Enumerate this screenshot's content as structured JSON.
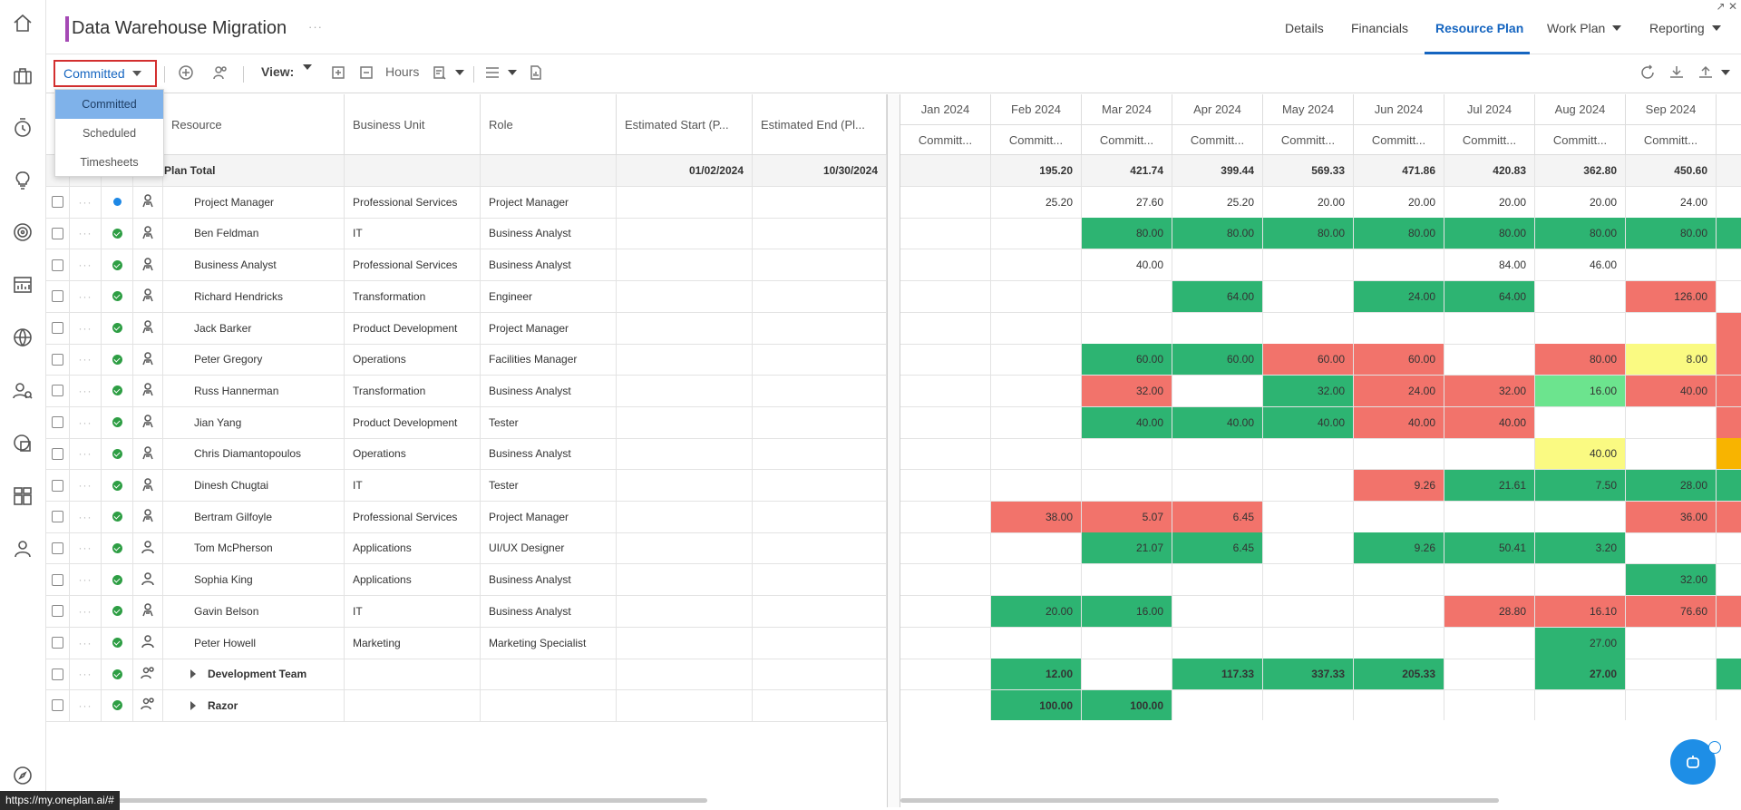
{
  "header": {
    "title": "Data Warehouse Migration",
    "title_more": "···",
    "tabs": [
      "Details",
      "Financials",
      "Resource Plan",
      "Work Plan",
      "Reporting"
    ],
    "active_tab": "Resource Plan"
  },
  "toolbar": {
    "mode_label": "Committed",
    "view_label": "View:",
    "units_label": "Hours"
  },
  "dropdown": {
    "options": [
      "Committed",
      "Scheduled",
      "Timesheets"
    ],
    "selected": "Committed"
  },
  "grid": {
    "headers": {
      "resource": "Resource",
      "business_unit": "Business Unit",
      "role": "Role",
      "est_start": "Estimated Start (P...",
      "est_end": "Estimated End (Pl..."
    },
    "months": [
      "Jan 2024",
      "Feb 2024",
      "Mar 2024",
      "Apr 2024",
      "May 2024",
      "Jun 2024",
      "Jul 2024",
      "Aug 2024",
      "Sep 2024"
    ],
    "month_sub": "Committ...",
    "month_sub_partial": "Co",
    "plan_total": {
      "label": "Plan Total",
      "start": "01/02/2024",
      "end": "10/30/2024",
      "values": [
        "",
        "195.20",
        "421.74",
        "399.44",
        "569.33",
        "471.86",
        "420.83",
        "362.80",
        "450.60"
      ]
    },
    "rows": [
      {
        "name": "Project Manager",
        "bu": "Professional Services",
        "role": "Project Manager",
        "status": "blue",
        "icon": "resource-generic",
        "values": [
          "",
          "25.20",
          "27.60",
          "25.20",
          "20.00",
          "20.00",
          "20.00",
          "20.00",
          "24.00"
        ],
        "colors": [
          "",
          "",
          "",
          "",
          "",
          "",
          "",
          "",
          "",
          ""
        ]
      },
      {
        "name": "Ben Feldman",
        "bu": "IT",
        "role": "Business Analyst",
        "status": "green",
        "icon": "resource-generic",
        "values": [
          "",
          "",
          "80.00",
          "80.00",
          "80.00",
          "80.00",
          "80.00",
          "80.00",
          "80.00"
        ],
        "colors": [
          "",
          "",
          "g",
          "g",
          "g",
          "g",
          "g",
          "g",
          "g",
          "g"
        ]
      },
      {
        "name": "Business Analyst",
        "bu": "Professional Services",
        "role": "Business Analyst",
        "status": "green",
        "icon": "resource-generic",
        "values": [
          "",
          "",
          "40.00",
          "",
          "",
          "",
          "84.00",
          "46.00",
          ""
        ],
        "colors": [
          "",
          "",
          "",
          "",
          "",
          "",
          "",
          "",
          "",
          ""
        ]
      },
      {
        "name": "Richard Hendricks",
        "bu": "Transformation",
        "role": "Engineer",
        "status": "green",
        "icon": "resource-generic",
        "values": [
          "",
          "",
          "",
          "64.00",
          "",
          "24.00",
          "64.00",
          "",
          "126.00"
        ],
        "colors": [
          "",
          "",
          "",
          "g",
          "",
          "g",
          "g",
          "",
          "r",
          ""
        ]
      },
      {
        "name": "Jack Barker",
        "bu": "Product Development",
        "role": "Project Manager",
        "status": "green",
        "icon": "resource-generic",
        "values": [
          "",
          "",
          "",
          "",
          "",
          "",
          "",
          "",
          ""
        ],
        "colors": [
          "",
          "",
          "",
          "",
          "",
          "",
          "",
          "",
          "",
          "r"
        ]
      },
      {
        "name": "Peter Gregory",
        "bu": "Operations",
        "role": "Facilities Manager",
        "status": "green",
        "icon": "resource-generic",
        "values": [
          "",
          "",
          "60.00",
          "60.00",
          "60.00",
          "60.00",
          "",
          "80.00",
          "8.00"
        ],
        "colors": [
          "",
          "",
          "g",
          "g",
          "r",
          "r",
          "",
          "r",
          "y",
          "r"
        ]
      },
      {
        "name": "Russ Hannerman",
        "bu": "Transformation",
        "role": "Business Analyst",
        "status": "green",
        "icon": "resource-generic",
        "values": [
          "",
          "",
          "32.00",
          "",
          "32.00",
          "24.00",
          "32.00",
          "16.00",
          "40.00"
        ],
        "colors": [
          "",
          "",
          "r",
          "",
          "g",
          "r",
          "r",
          "lg",
          "r",
          "r"
        ]
      },
      {
        "name": "Jian Yang",
        "bu": "Product Development",
        "role": "Tester",
        "status": "green",
        "icon": "resource-generic",
        "values": [
          "",
          "",
          "40.00",
          "40.00",
          "40.00",
          "40.00",
          "40.00",
          "",
          ""
        ],
        "colors": [
          "",
          "",
          "g",
          "g",
          "g",
          "r",
          "r",
          "",
          "",
          "r"
        ]
      },
      {
        "name": "Chris Diamantopoulos",
        "bu": "Operations",
        "role": "Business Analyst",
        "status": "green",
        "icon": "resource-generic",
        "values": [
          "",
          "",
          "",
          "",
          "",
          "",
          "",
          "40.00",
          ""
        ],
        "colors": [
          "",
          "",
          "",
          "",
          "",
          "",
          "",
          "y",
          "",
          "o"
        ]
      },
      {
        "name": "Dinesh Chugtai",
        "bu": "IT",
        "role": "Tester",
        "status": "green",
        "icon": "resource-generic",
        "values": [
          "",
          "",
          "",
          "",
          "",
          "9.26",
          "21.61",
          "7.50",
          "28.00"
        ],
        "colors": [
          "",
          "",
          "",
          "",
          "",
          "r",
          "g",
          "g",
          "g",
          "g"
        ]
      },
      {
        "name": "Bertram Gilfoyle",
        "bu": "Professional Services",
        "role": "Project Manager",
        "status": "green",
        "icon": "resource-generic",
        "values": [
          "",
          "38.00",
          "5.07",
          "6.45",
          "",
          "",
          "",
          "",
          "36.00"
        ],
        "colors": [
          "",
          "r",
          "r",
          "r",
          "",
          "",
          "",
          "",
          "r",
          "r"
        ]
      },
      {
        "name": "Tom McPherson",
        "bu": "Applications",
        "role": "UI/UX Designer",
        "status": "green",
        "icon": "person",
        "values": [
          "",
          "",
          "21.07",
          "6.45",
          "",
          "9.26",
          "50.41",
          "3.20",
          ""
        ],
        "colors": [
          "",
          "",
          "g",
          "g",
          "",
          "g",
          "g",
          "g",
          "",
          ""
        ]
      },
      {
        "name": "Sophia King",
        "bu": "Applications",
        "role": "Business Analyst",
        "status": "green",
        "icon": "person",
        "values": [
          "",
          "",
          "",
          "",
          "",
          "",
          "",
          "",
          "32.00"
        ],
        "colors": [
          "",
          "",
          "",
          "",
          "",
          "",
          "",
          "",
          "g",
          ""
        ]
      },
      {
        "name": "Gavin Belson",
        "bu": "IT",
        "role": "Business Analyst",
        "status": "green",
        "icon": "resource-generic",
        "values": [
          "",
          "20.00",
          "16.00",
          "",
          "",
          "",
          "28.80",
          "16.10",
          "76.60"
        ],
        "colors": [
          "",
          "g",
          "g",
          "",
          "",
          "",
          "r",
          "r",
          "r",
          "r"
        ]
      },
      {
        "name": "Peter Howell",
        "bu": "Marketing",
        "role": "Marketing Specialist",
        "status": "green",
        "icon": "person",
        "values": [
          "",
          "",
          "",
          "",
          "",
          "",
          "",
          "27.00",
          ""
        ],
        "colors": [
          "",
          "",
          "",
          "",
          "",
          "",
          "",
          "g",
          "",
          ""
        ]
      },
      {
        "name": "Development Team",
        "bu": "",
        "role": "",
        "status": "green",
        "icon": "team",
        "group": true,
        "values": [
          "",
          "12.00",
          "",
          "117.33",
          "337.33",
          "205.33",
          "",
          "27.00",
          ""
        ],
        "colors": [
          "",
          "g",
          "",
          "g",
          "g",
          "g",
          "",
          "g",
          "",
          "g"
        ]
      },
      {
        "name": "Razor",
        "bu": "",
        "role": "",
        "status": "green",
        "icon": "team",
        "group": true,
        "values": [
          "",
          "100.00",
          "100.00",
          "",
          "",
          "",
          "",
          "",
          ""
        ],
        "colors": [
          "",
          "g",
          "g",
          "",
          "",
          "",
          "",
          "",
          "",
          ""
        ]
      }
    ]
  },
  "status_url": "https://my.oneplan.ai/#"
}
